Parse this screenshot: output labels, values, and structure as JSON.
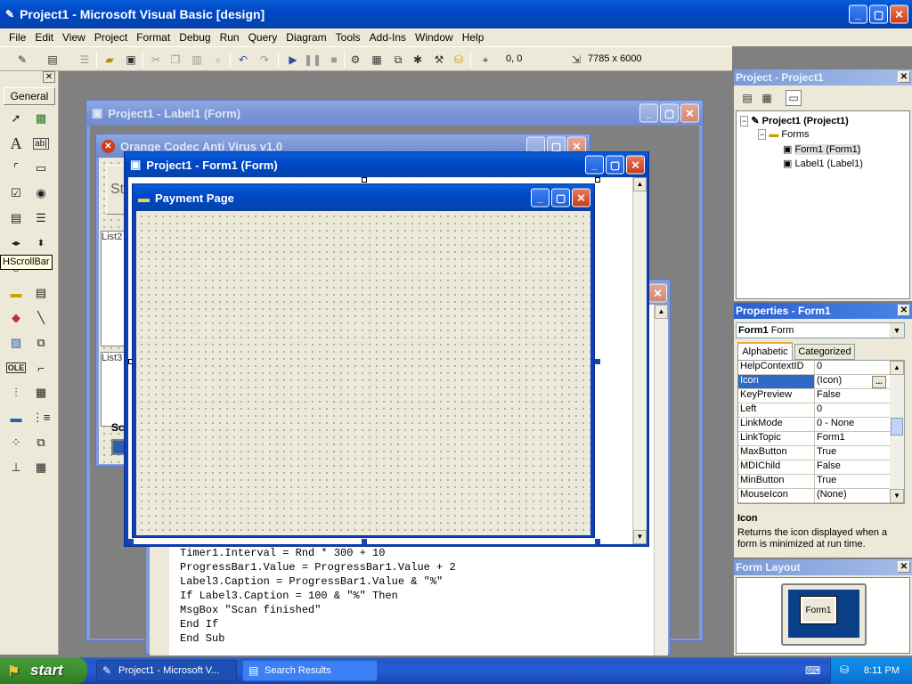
{
  "app": {
    "title": "Project1 - Microsoft Visual Basic [design]"
  },
  "menu": [
    "File",
    "Edit",
    "View",
    "Project",
    "Format",
    "Debug",
    "Run",
    "Query",
    "Diagram",
    "Tools",
    "Add-Ins",
    "Window",
    "Help"
  ],
  "toolbar": {
    "position": "0, 0",
    "size": "7785 x 6000"
  },
  "toolbox": {
    "tab_label": "General",
    "tooltip": "HScrollBar",
    "icons": [
      "pointer-icon",
      "picturebox-icon",
      "label-icon",
      "textbox-icon",
      "frame-icon",
      "commandbutton-icon",
      "checkbox-icon",
      "optionbutton-icon",
      "combobox-icon",
      "listbox-icon",
      "hscrollbar-icon",
      "vscrollbar-icon",
      "timer-icon",
      "drivelistbox-icon",
      "dirlistbox-icon",
      "filelistbox-icon",
      "shape-icon",
      "line-icon",
      "image-icon",
      "data-icon",
      "ole-icon",
      "animation-icon",
      "slider-icon",
      "treeview-icon",
      "progressbar-icon",
      "imagelist-icon",
      "listview-icon",
      "toolbar-icon"
    ]
  },
  "windows": {
    "label1_form_title": "Project1 - Label1 (Form)",
    "antivirus_title": "Orange Codec Anti Virus v1.0",
    "antivirus_st": "St",
    "antivirus_list2": "List2",
    "antivirus_list3": "List3",
    "antivirus_sc": "Sc",
    "form1_title": "Project1 - Form1 (Form)",
    "payment_title": "Payment Page"
  },
  "code": [
    "Timer1.Interval = Rnd * 300 + 10",
    "ProgressBar1.Value = ProgressBar1.Value + 2",
    "Label3.Caption = ProgressBar1.Value & \"%\"",
    "If Label3.Caption = 100 & \"%\" Then",
    "MsgBox \"Scan finished\"",
    "End If",
    "End Sub"
  ],
  "project_panel": {
    "title": "Project - Project1",
    "root": "Project1 (Project1)",
    "folder": "Forms",
    "items": [
      "Form1 (Form1)",
      "Label1 (Label1)"
    ]
  },
  "properties_panel": {
    "title": "Properties - Form1",
    "object_name": "Form1",
    "object_type": "Form",
    "tabs": [
      "Alphabetic",
      "Categorized"
    ],
    "rows": [
      {
        "name": "HelpContextID",
        "value": "0"
      },
      {
        "name": "Icon",
        "value": "(Icon)"
      },
      {
        "name": "KeyPreview",
        "value": "False"
      },
      {
        "name": "Left",
        "value": "0"
      },
      {
        "name": "LinkMode",
        "value": "0 - None"
      },
      {
        "name": "LinkTopic",
        "value": "Form1"
      },
      {
        "name": "MaxButton",
        "value": "True"
      },
      {
        "name": "MDIChild",
        "value": "False"
      },
      {
        "name": "MinButton",
        "value": "True"
      },
      {
        "name": "MouseIcon",
        "value": "(None)"
      }
    ],
    "desc_title": "Icon",
    "desc_text": "Returns the icon displayed when a form is minimized at run time."
  },
  "form_layout": {
    "title": "Form Layout",
    "form_label": "Form1"
  },
  "taskbar": {
    "start": "start",
    "tasks": [
      "Project1 - Microsoft V...",
      "Search Results"
    ],
    "clock": "8:11 PM"
  }
}
